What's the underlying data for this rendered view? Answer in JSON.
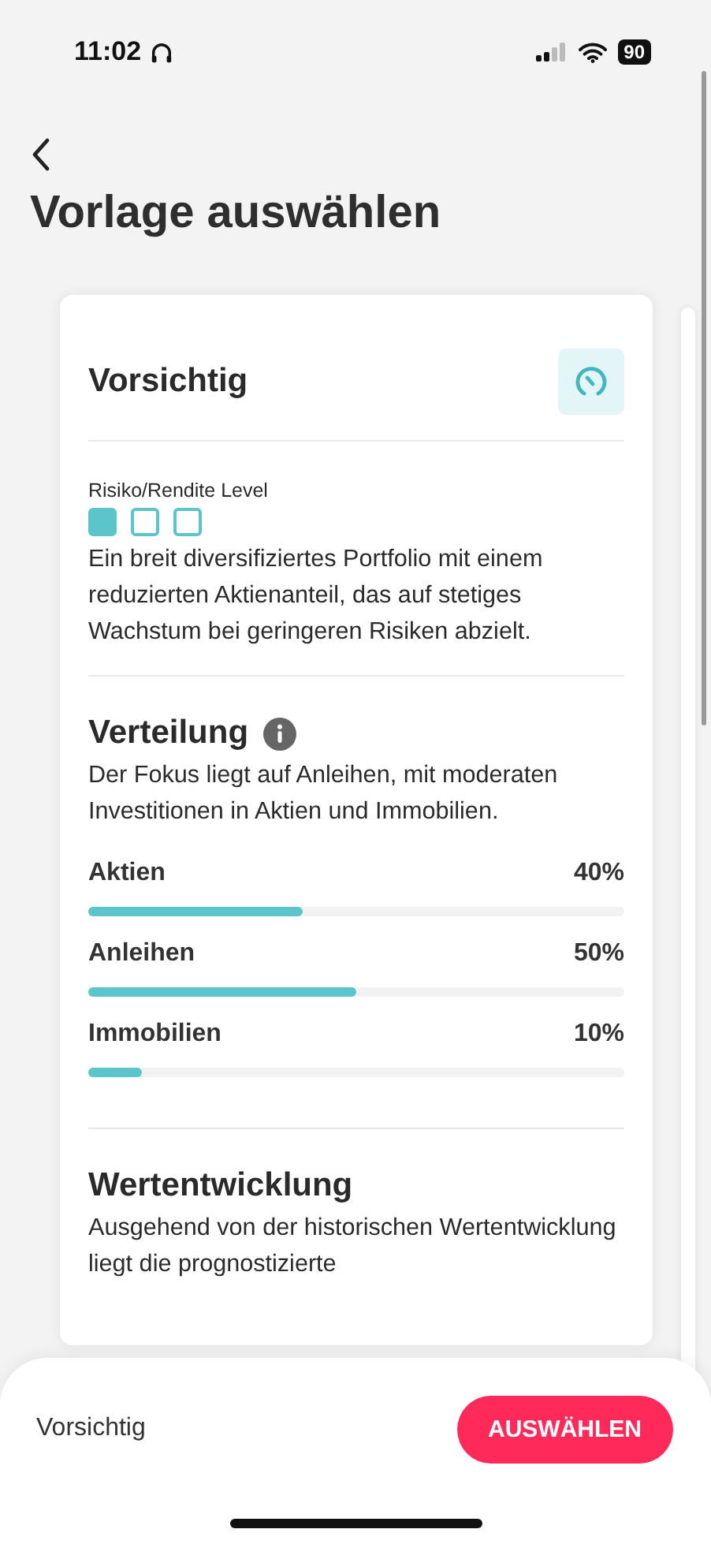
{
  "status_bar": {
    "time": "11:02",
    "battery": "90"
  },
  "header": {
    "title": "Vorlage auswählen"
  },
  "card": {
    "title": "Vorsichtig",
    "risk": {
      "label": "Risiko/Rendite Level",
      "squares": [
        {
          "filled": true
        },
        {
          "filled": false
        },
        {
          "filled": false
        }
      ]
    },
    "description": "Ein breit diversifiziertes Portfolio mit einem reduzierten Aktienanteil, das auf stetiges Wachstum bei geringeren Risiken abzielt.",
    "distribution": {
      "title": "Verteilung",
      "description": "Der Fokus liegt auf Anleihen, mit moderaten Investitionen in Aktien und Immobilien.",
      "items": [
        {
          "name": "Aktien",
          "reading": "40%",
          "level": 0.4
        },
        {
          "name": "Anleihen",
          "reading": "50%",
          "level": 0.5
        },
        {
          "name": "Immobilien",
          "reading": "10%",
          "level": 0.1
        }
      ]
    },
    "performance": {
      "title": "Wertentwicklung",
      "description": "Ausgehend von der historischen Wertentwicklung liegt die prognostizierte"
    }
  },
  "bottom_bar": {
    "selection": "Vorsichtig",
    "button": "AUSWÄHLEN"
  }
}
